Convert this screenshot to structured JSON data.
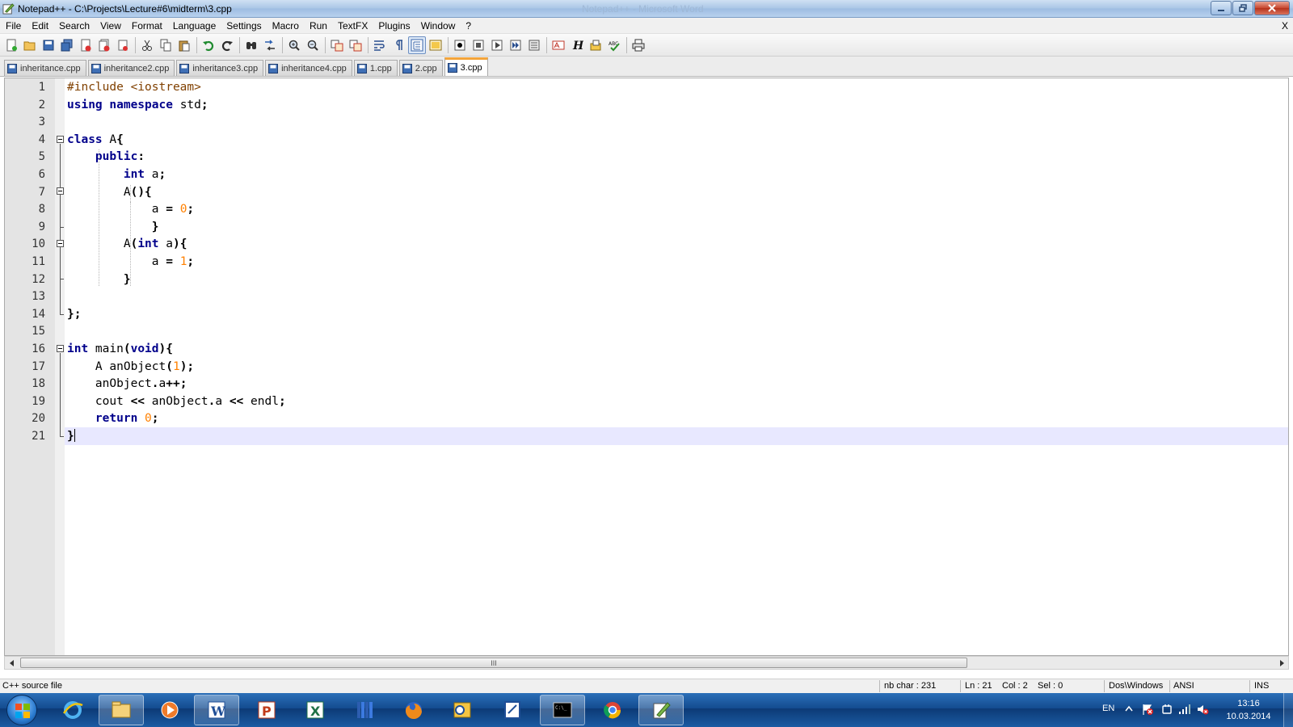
{
  "window": {
    "title": "Notepad++ - C:\\Projects\\Lecture#6\\midterm\\3.cpp",
    "ghost_title": "Notepad++  -  Microsoft Word"
  },
  "menu": {
    "items": [
      "File",
      "Edit",
      "Search",
      "View",
      "Format",
      "Language",
      "Settings",
      "Macro",
      "Run",
      "TextFX",
      "Plugins",
      "Window",
      "?"
    ],
    "close_label": "X"
  },
  "toolbar": {
    "buttons": [
      "new-file-icon",
      "open-file-icon",
      "save-icon",
      "save-all-icon",
      "close-icon",
      "close-all-icon",
      "print-icon",
      "cut-icon",
      "copy-icon",
      "paste-icon",
      "undo-icon",
      "redo-icon",
      "find-icon",
      "replace-icon",
      "zoom-in-icon",
      "zoom-out-icon",
      "sync-vertical-icon",
      "sync-horizontal-icon",
      "word-wrap-icon",
      "show-all-chars-icon",
      "indent-guide-icon",
      "document-map-icon",
      "record-macro-icon",
      "stop-macro-icon",
      "play-macro-icon",
      "run-macro-multiple-icon",
      "save-macro-icon",
      "spell-check-icon",
      "html-tidy-icon",
      "plugin-manager-icon",
      "abc-spell-icon",
      "print-now-icon"
    ]
  },
  "tabs": [
    {
      "label": "inheritance.cpp",
      "active": false
    },
    {
      "label": "inheritance2.cpp",
      "active": false
    },
    {
      "label": "inheritance3.cpp",
      "active": false
    },
    {
      "label": "inheritance4.cpp",
      "active": false
    },
    {
      "label": "1.cpp",
      "active": false
    },
    {
      "label": "2.cpp",
      "active": false
    },
    {
      "label": "3.cpp",
      "active": true
    }
  ],
  "editor": {
    "current_line": 21,
    "lines": [
      "#include <iostream>",
      "using namespace std;",
      "",
      "class A{",
      "    public:",
      "        int a;",
      "        A(){",
      "            a = 0;",
      "            }",
      "        A(int a){",
      "            a = 1;",
      "        }",
      "",
      "};",
      "",
      "int main(void){",
      "    A anObject(1);",
      "    anObject.a++;",
      "    cout << anObject.a << endl;",
      "    return 0;",
      "}"
    ]
  },
  "scrollbar": {
    "thumb_grip": "III"
  },
  "status": {
    "file_type": "C++ source file",
    "nb_char": "nb char : 231",
    "ln": "Ln : 21",
    "col": "Col : 2",
    "sel": "Sel : 0",
    "eol": "Dos\\Windows",
    "encoding": "ANSI",
    "mode": "INS"
  },
  "taskbar": {
    "apps": [
      "ie-icon",
      "explorer-icon",
      "media-player-icon",
      "word-icon",
      "powerpoint-icon",
      "excel-icon",
      "library-icon",
      "firefox-icon",
      "outlook-icon",
      "paint-icon",
      "cmd-icon",
      "chrome-icon",
      "notepadpp-icon"
    ],
    "language": "EN",
    "time": "13:16",
    "date": "10.03.2014"
  }
}
